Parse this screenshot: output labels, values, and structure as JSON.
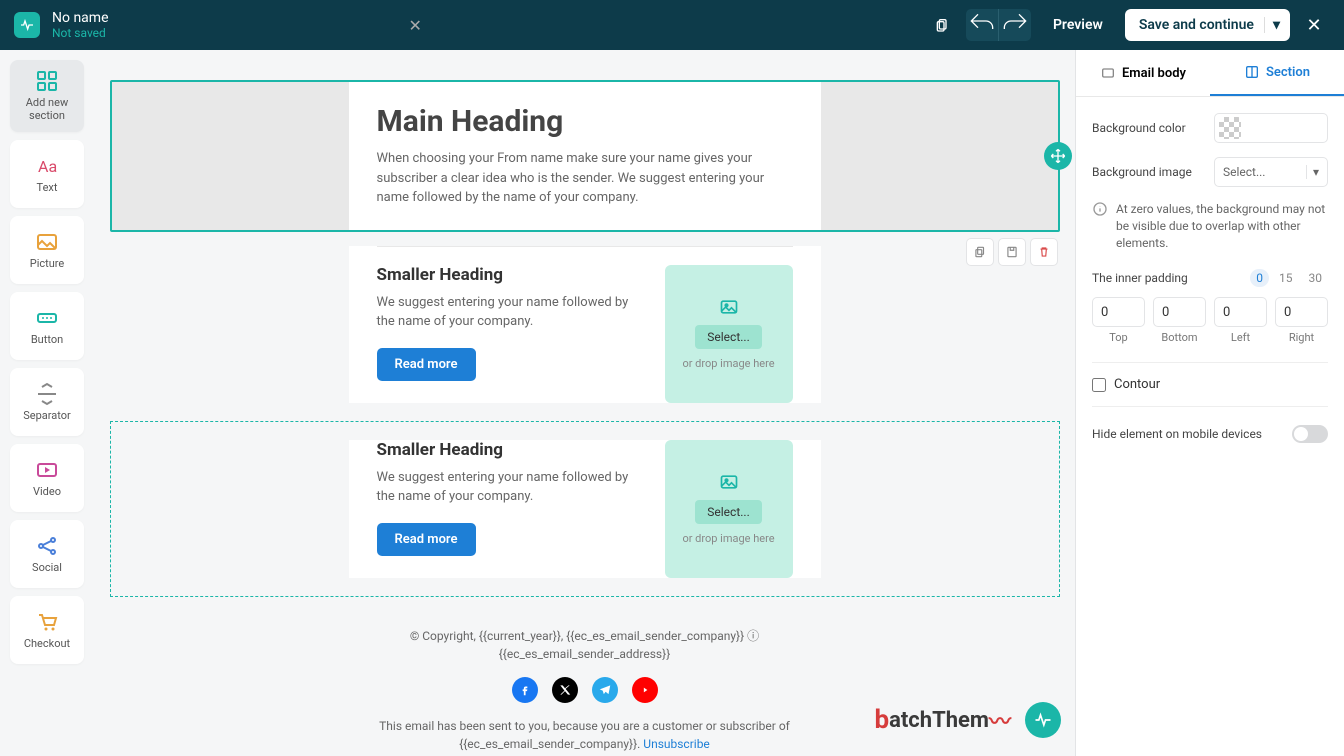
{
  "topbar": {
    "title": "No name",
    "subtitle": "Not saved",
    "preview": "Preview",
    "save": "Save and continue"
  },
  "sidebar": {
    "add": "Add new\nsection",
    "text": "Text",
    "picture": "Picture",
    "button": "Button",
    "separator": "Separator",
    "video": "Video",
    "social": "Social",
    "checkout": "Checkout"
  },
  "canvas": {
    "main_heading": "Main Heading",
    "main_para": "When choosing your From name make sure your name gives your subscriber a clear idea who is the sender. We suggest entering your name followed by the name of your company.",
    "smaller_heading": "Smaller Heading",
    "smaller_para": "We suggest entering your name followed by the name of your company.",
    "read_more": "Read more",
    "select": "Select...",
    "drop_hint": "or drop image here",
    "copyright": "© Copyright, {{current_year}}, {{ec_es_email_sender_company}} ⓘ",
    "address": "{{ec_es_email_sender_address}}",
    "sent_notice": "This email has been sent to you, because you are a customer or subscriber of {{ec_es_email_sender_company}}. ",
    "unsubscribe": "Unsubscribe"
  },
  "panel": {
    "tab_email": "Email body",
    "tab_section": "Section",
    "bg_color": "Background color",
    "bg_image": "Background image",
    "select": "Select...",
    "info": "At zero values, the background may not be visible due to overlap with other elements.",
    "inner_padding": "The inner padding",
    "presets": [
      "0",
      "15",
      "30"
    ],
    "pad_top": "Top",
    "pad_bottom": "Bottom",
    "pad_left": "Left",
    "pad_right": "Right",
    "pad_val": "0",
    "contour": "Contour",
    "hide_mobile": "Hide element on mobile devices"
  },
  "watermark": "atchThem"
}
